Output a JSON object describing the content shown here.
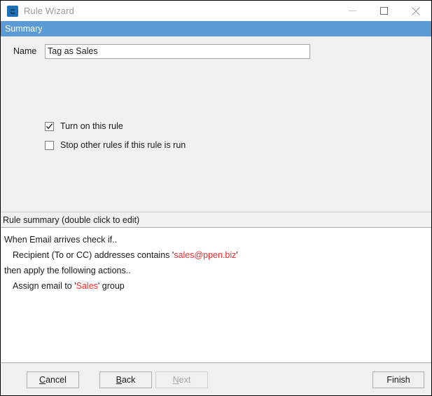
{
  "window": {
    "title": "Rule Wizard",
    "icon": "rule-wizard-app-icon",
    "icon_glyph": "e",
    "controls": {
      "minimize": "minimize-icon",
      "maximize": "maximize-icon",
      "close": "close-icon"
    }
  },
  "section": {
    "header": "Summary",
    "header_color": "#5B9BD5"
  },
  "form": {
    "name_label": "Name",
    "name_value": "Tag as Sales",
    "name_placeholder": "",
    "checkboxes": [
      {
        "label": "Turn on this rule",
        "checked": true
      },
      {
        "label": "Stop other rules if this rule is run",
        "checked": false
      }
    ]
  },
  "summary": {
    "label": "Rule summary (double click to edit)",
    "highlight_color": "#FF2B2B",
    "lines": [
      {
        "indent": false,
        "pre": "When Email arrives check if..",
        "highlight": "",
        "post": ""
      },
      {
        "indent": true,
        "pre": "Recipient (To or CC) addresses contains '",
        "highlight": "sales@ppen.biz",
        "post": "'"
      },
      {
        "indent": false,
        "pre": "then apply the following actions..",
        "highlight": "",
        "post": ""
      },
      {
        "indent": true,
        "pre": "Assign email to '",
        "highlight": "Sales",
        "post": "' group"
      }
    ]
  },
  "footer": {
    "buttons": [
      {
        "label": "Cancel",
        "mnemonic": "C",
        "rest": "ancel",
        "enabled": true
      },
      {
        "label": "Back",
        "mnemonic": "B",
        "rest": "ack",
        "enabled": true
      },
      {
        "label": "Next",
        "mnemonic": "N",
        "rest": "ext",
        "enabled": false
      },
      {
        "label": "Finish",
        "mnemonic": "",
        "rest": "Finish",
        "enabled": true
      }
    ]
  }
}
